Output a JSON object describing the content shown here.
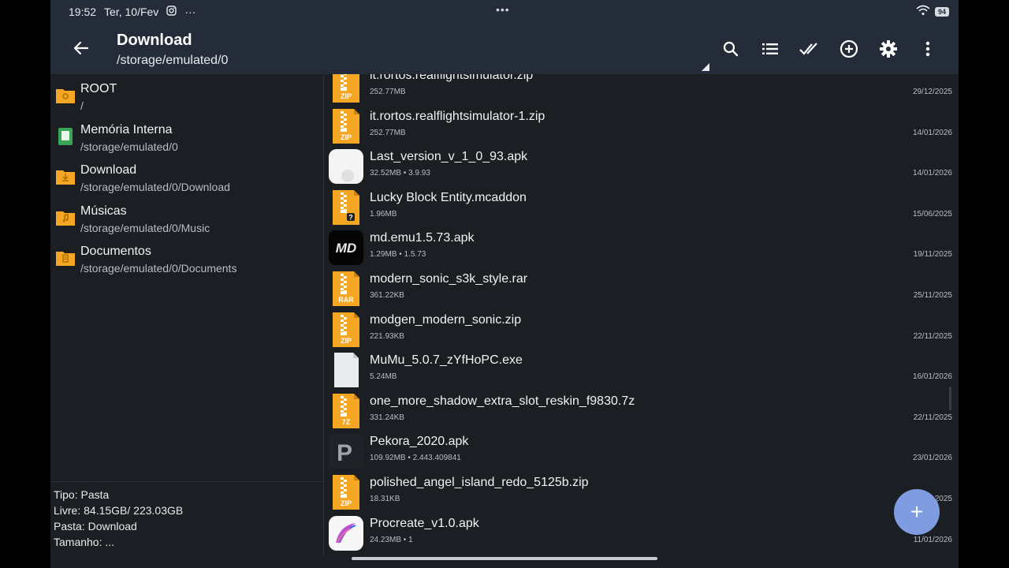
{
  "status_bar": {
    "time": "19:52",
    "date": "Ter, 10/Fev",
    "more": "···",
    "center_dots": "•••",
    "battery": "94",
    "icons": [
      "instagram-icon",
      "wifi-icon",
      "battery-icon"
    ]
  },
  "app_bar": {
    "title": "Download",
    "subtitle": "/storage/emulated/0",
    "actions": [
      "search-icon",
      "list-view-icon",
      "select-all-icon",
      "add-circle-icon",
      "gear-icon",
      "more-vert-icon"
    ]
  },
  "bookmarks": [
    {
      "name": "ROOT",
      "path": "/",
      "icon": "root-folder-icon"
    },
    {
      "name": "Memória Interna",
      "path": "/storage/emulated/0",
      "icon": "sd-card-icon"
    },
    {
      "name": "Download",
      "path": "/storage/emulated/0/Download",
      "icon": "download-folder-icon"
    },
    {
      "name": "Músicas",
      "path": "/storage/emulated/0/Music",
      "icon": "music-folder-icon"
    },
    {
      "name": "Documentos",
      "path": "/storage/emulated/0/Documents",
      "icon": "documents-folder-icon"
    }
  ],
  "info": {
    "tipo": "Tipo: Pasta",
    "livre": "Livre: 84.15GB/ 223.03GB",
    "pasta": "Pasta: Download",
    "tamanho": "Tamanho: ..."
  },
  "files": [
    {
      "name": "it.rortos.realflightsimulator.zip",
      "meta": "252.77MB",
      "date": "29/12/2025",
      "type": "zip",
      "label": "ZIP"
    },
    {
      "name": "it.rortos.realflightsimulator-1.zip",
      "meta": "252.77MB",
      "date": "14/01/2026",
      "type": "zip",
      "label": "ZIP"
    },
    {
      "name": "Last_version_v_1_0_93.apk",
      "meta": "32.52MB  •  3.9.93",
      "date": "14/01/2026",
      "type": "apk-white",
      "label": ""
    },
    {
      "name": "Lucky Block Entity.mcaddon",
      "meta": "1.96MB",
      "date": "15/06/2025",
      "type": "unknown",
      "label": "?"
    },
    {
      "name": "md.emu1.5.73.apk",
      "meta": "1.29MB  •  1.5.73",
      "date": "19/11/2025",
      "type": "apk-md",
      "label": "MD"
    },
    {
      "name": "modern_sonic_s3k_style.rar",
      "meta": "361.22KB",
      "date": "25/11/2025",
      "type": "zip",
      "label": "RAR"
    },
    {
      "name": "modgen_modern_sonic.zip",
      "meta": "221.93KB",
      "date": "22/11/2025",
      "type": "zip",
      "label": "ZIP"
    },
    {
      "name": "MuMu_5.0.7_zYfHoPC.exe",
      "meta": "5.24MB",
      "date": "16/01/2026",
      "type": "blank",
      "label": ""
    },
    {
      "name": "one_more_shadow_extra_slot_reskin_f9830.7z",
      "meta": "331.24KB",
      "date": "22/11/2025",
      "type": "zip",
      "label": "7Z"
    },
    {
      "name": "Pekora_2020.apk",
      "meta": "109.92MB  •  2.443.409841",
      "date": "23/01/2026",
      "type": "apk-p",
      "label": "P"
    },
    {
      "name": "polished_angel_island_redo_5125b.zip",
      "meta": "18.31KB",
      "date": "2025",
      "type": "zip",
      "label": "ZIP"
    },
    {
      "name": "Procreate_v1.0.apk",
      "meta": "24.23MB  •  1",
      "date": "11/01/2026",
      "type": "apk-procreate",
      "label": ""
    }
  ],
  "fab": {
    "icon": "plus-icon",
    "glyph": "+"
  },
  "colors": {
    "accent": "#7f9ce0",
    "archive": "#f5a623",
    "appbar": "#242c39",
    "background": "#1b1e22"
  }
}
